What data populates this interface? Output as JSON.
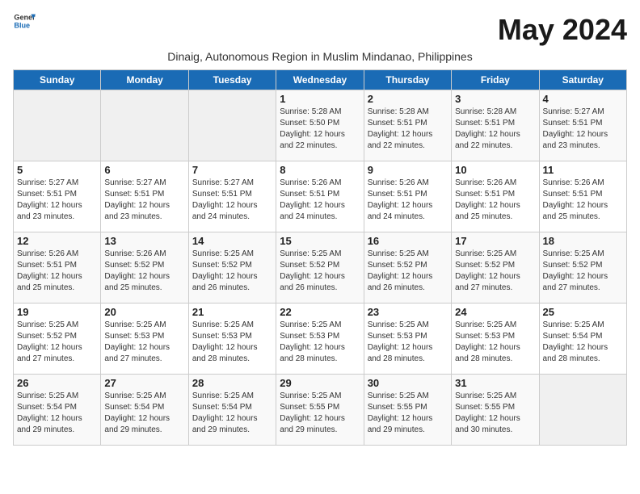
{
  "logo": {
    "general": "General",
    "blue": "Blue"
  },
  "title": "May 2024",
  "subtitle": "Dinaig, Autonomous Region in Muslim Mindanao, Philippines",
  "weekdays": [
    "Sunday",
    "Monday",
    "Tuesday",
    "Wednesday",
    "Thursday",
    "Friday",
    "Saturday"
  ],
  "weeks": [
    [
      {
        "day": "",
        "sunrise": "",
        "sunset": "",
        "daylight": ""
      },
      {
        "day": "",
        "sunrise": "",
        "sunset": "",
        "daylight": ""
      },
      {
        "day": "",
        "sunrise": "",
        "sunset": "",
        "daylight": ""
      },
      {
        "day": "1",
        "sunrise": "Sunrise: 5:28 AM",
        "sunset": "Sunset: 5:50 PM",
        "daylight": "Daylight: 12 hours and 22 minutes."
      },
      {
        "day": "2",
        "sunrise": "Sunrise: 5:28 AM",
        "sunset": "Sunset: 5:51 PM",
        "daylight": "Daylight: 12 hours and 22 minutes."
      },
      {
        "day": "3",
        "sunrise": "Sunrise: 5:28 AM",
        "sunset": "Sunset: 5:51 PM",
        "daylight": "Daylight: 12 hours and 22 minutes."
      },
      {
        "day": "4",
        "sunrise": "Sunrise: 5:27 AM",
        "sunset": "Sunset: 5:51 PM",
        "daylight": "Daylight: 12 hours and 23 minutes."
      }
    ],
    [
      {
        "day": "5",
        "sunrise": "Sunrise: 5:27 AM",
        "sunset": "Sunset: 5:51 PM",
        "daylight": "Daylight: 12 hours and 23 minutes."
      },
      {
        "day": "6",
        "sunrise": "Sunrise: 5:27 AM",
        "sunset": "Sunset: 5:51 PM",
        "daylight": "Daylight: 12 hours and 23 minutes."
      },
      {
        "day": "7",
        "sunrise": "Sunrise: 5:27 AM",
        "sunset": "Sunset: 5:51 PM",
        "daylight": "Daylight: 12 hours and 24 minutes."
      },
      {
        "day": "8",
        "sunrise": "Sunrise: 5:26 AM",
        "sunset": "Sunset: 5:51 PM",
        "daylight": "Daylight: 12 hours and 24 minutes."
      },
      {
        "day": "9",
        "sunrise": "Sunrise: 5:26 AM",
        "sunset": "Sunset: 5:51 PM",
        "daylight": "Daylight: 12 hours and 24 minutes."
      },
      {
        "day": "10",
        "sunrise": "Sunrise: 5:26 AM",
        "sunset": "Sunset: 5:51 PM",
        "daylight": "Daylight: 12 hours and 25 minutes."
      },
      {
        "day": "11",
        "sunrise": "Sunrise: 5:26 AM",
        "sunset": "Sunset: 5:51 PM",
        "daylight": "Daylight: 12 hours and 25 minutes."
      }
    ],
    [
      {
        "day": "12",
        "sunrise": "Sunrise: 5:26 AM",
        "sunset": "Sunset: 5:51 PM",
        "daylight": "Daylight: 12 hours and 25 minutes."
      },
      {
        "day": "13",
        "sunrise": "Sunrise: 5:26 AM",
        "sunset": "Sunset: 5:52 PM",
        "daylight": "Daylight: 12 hours and 25 minutes."
      },
      {
        "day": "14",
        "sunrise": "Sunrise: 5:25 AM",
        "sunset": "Sunset: 5:52 PM",
        "daylight": "Daylight: 12 hours and 26 minutes."
      },
      {
        "day": "15",
        "sunrise": "Sunrise: 5:25 AM",
        "sunset": "Sunset: 5:52 PM",
        "daylight": "Daylight: 12 hours and 26 minutes."
      },
      {
        "day": "16",
        "sunrise": "Sunrise: 5:25 AM",
        "sunset": "Sunset: 5:52 PM",
        "daylight": "Daylight: 12 hours and 26 minutes."
      },
      {
        "day": "17",
        "sunrise": "Sunrise: 5:25 AM",
        "sunset": "Sunset: 5:52 PM",
        "daylight": "Daylight: 12 hours and 27 minutes."
      },
      {
        "day": "18",
        "sunrise": "Sunrise: 5:25 AM",
        "sunset": "Sunset: 5:52 PM",
        "daylight": "Daylight: 12 hours and 27 minutes."
      }
    ],
    [
      {
        "day": "19",
        "sunrise": "Sunrise: 5:25 AM",
        "sunset": "Sunset: 5:52 PM",
        "daylight": "Daylight: 12 hours and 27 minutes."
      },
      {
        "day": "20",
        "sunrise": "Sunrise: 5:25 AM",
        "sunset": "Sunset: 5:53 PM",
        "daylight": "Daylight: 12 hours and 27 minutes."
      },
      {
        "day": "21",
        "sunrise": "Sunrise: 5:25 AM",
        "sunset": "Sunset: 5:53 PM",
        "daylight": "Daylight: 12 hours and 28 minutes."
      },
      {
        "day": "22",
        "sunrise": "Sunrise: 5:25 AM",
        "sunset": "Sunset: 5:53 PM",
        "daylight": "Daylight: 12 hours and 28 minutes."
      },
      {
        "day": "23",
        "sunrise": "Sunrise: 5:25 AM",
        "sunset": "Sunset: 5:53 PM",
        "daylight": "Daylight: 12 hours and 28 minutes."
      },
      {
        "day": "24",
        "sunrise": "Sunrise: 5:25 AM",
        "sunset": "Sunset: 5:53 PM",
        "daylight": "Daylight: 12 hours and 28 minutes."
      },
      {
        "day": "25",
        "sunrise": "Sunrise: 5:25 AM",
        "sunset": "Sunset: 5:54 PM",
        "daylight": "Daylight: 12 hours and 28 minutes."
      }
    ],
    [
      {
        "day": "26",
        "sunrise": "Sunrise: 5:25 AM",
        "sunset": "Sunset: 5:54 PM",
        "daylight": "Daylight: 12 hours and 29 minutes."
      },
      {
        "day": "27",
        "sunrise": "Sunrise: 5:25 AM",
        "sunset": "Sunset: 5:54 PM",
        "daylight": "Daylight: 12 hours and 29 minutes."
      },
      {
        "day": "28",
        "sunrise": "Sunrise: 5:25 AM",
        "sunset": "Sunset: 5:54 PM",
        "daylight": "Daylight: 12 hours and 29 minutes."
      },
      {
        "day": "29",
        "sunrise": "Sunrise: 5:25 AM",
        "sunset": "Sunset: 5:55 PM",
        "daylight": "Daylight: 12 hours and 29 minutes."
      },
      {
        "day": "30",
        "sunrise": "Sunrise: 5:25 AM",
        "sunset": "Sunset: 5:55 PM",
        "daylight": "Daylight: 12 hours and 29 minutes."
      },
      {
        "day": "31",
        "sunrise": "Sunrise: 5:25 AM",
        "sunset": "Sunset: 5:55 PM",
        "daylight": "Daylight: 12 hours and 30 minutes."
      },
      {
        "day": "",
        "sunrise": "",
        "sunset": "",
        "daylight": ""
      }
    ]
  ]
}
